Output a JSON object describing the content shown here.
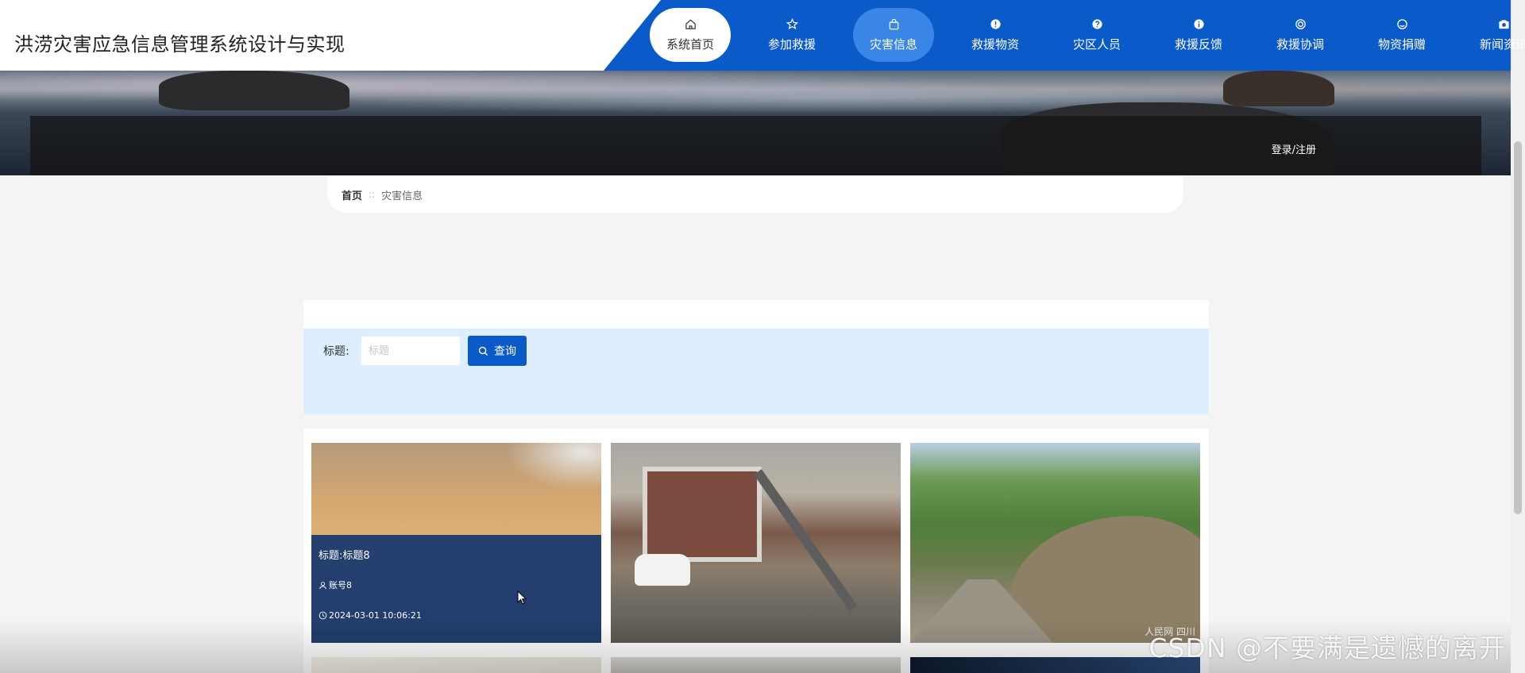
{
  "site_title": "洪涝灾害应急信息管理系统设计与实现",
  "nav": [
    {
      "label": "系统首页",
      "icon": "home-icon"
    },
    {
      "label": "参加救援",
      "icon": "star-icon"
    },
    {
      "label": "灾害信息",
      "icon": "bag-icon"
    },
    {
      "label": "救援物资",
      "icon": "alert-icon"
    },
    {
      "label": "灾区人员",
      "icon": "question-icon"
    },
    {
      "label": "救援反馈",
      "icon": "info-icon"
    },
    {
      "label": "救援协调",
      "icon": "target-icon"
    },
    {
      "label": "物资捐赠",
      "icon": "smile-icon"
    },
    {
      "label": "新闻资讯",
      "icon": "camera-icon"
    }
  ],
  "login_link": "登录/注册",
  "breadcrumb": {
    "home": "首页",
    "separator": "::",
    "current": "灾害信息"
  },
  "search": {
    "label": "标题:",
    "placeholder": "标题",
    "value": "",
    "button": "查询"
  },
  "cards": [
    {
      "title": "标题:标题8",
      "account": "账号8",
      "time": "2024-03-01 10:06:21",
      "image": "sandstorm"
    },
    {
      "image": "earthquake-house"
    },
    {
      "image": "landslide",
      "image_watermark": "人民网 四川"
    }
  ],
  "watermark": "CSDN @不要满是遗憾的离开",
  "colors": {
    "primary": "#0a5ac9",
    "search_bg": "#ddefff",
    "card_overlay": "#0a306e"
  }
}
